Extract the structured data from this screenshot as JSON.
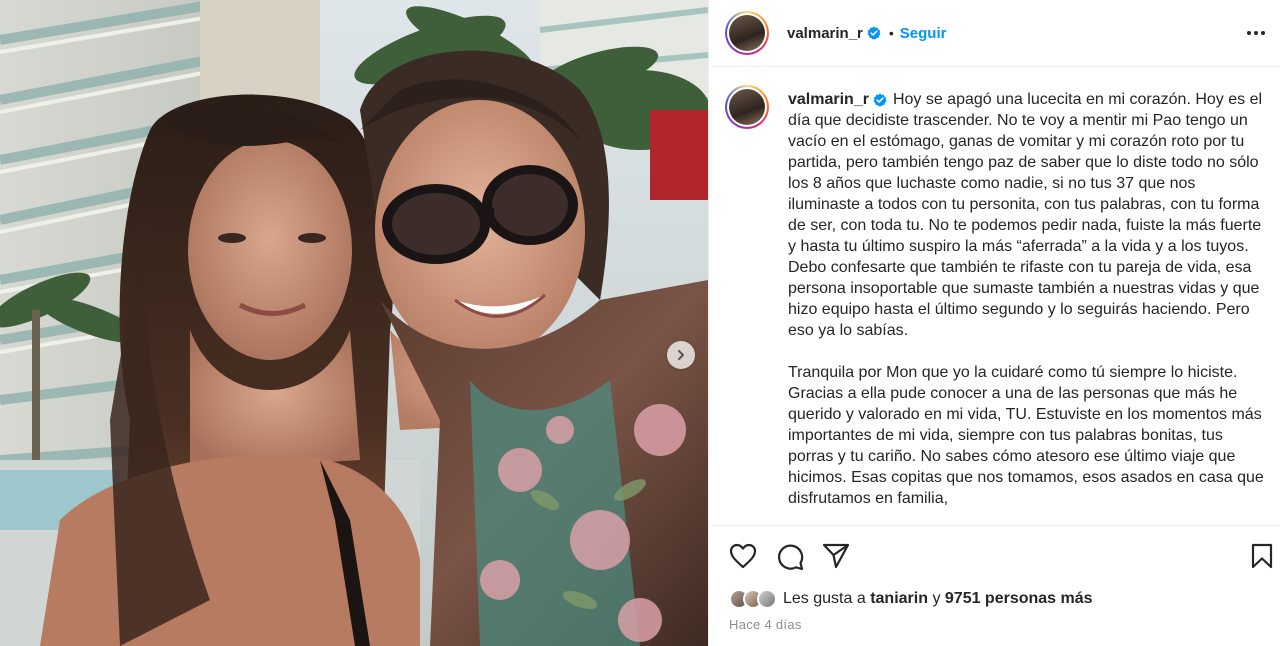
{
  "post": {
    "username": "valmarin_r",
    "follow_label": "Seguir",
    "dot": "•",
    "caption_username": "valmarin_r",
    "caption_paragraphs": [
      "Hoy se apagó una lucecita en mi corazón. Hoy es el día que decidiste trascender. No te voy a mentir mi Pao tengo un vacío en el estómago, ganas de vomitar y mi corazón roto por tu partida, pero también tengo paz de saber que lo diste todo no sólo los 8 años que luchaste como nadie, si no tus 37 que nos iluminaste a todos con tu personita, con tus palabras, con tu forma de ser, con toda tu. No te podemos pedir nada, fuiste la más fuerte y hasta tu último suspiro la más “aferrada” a la vida y a los tuyos.",
      "Debo confesarte que también te rifaste con tu pareja de vida, esa persona insoportable que sumaste también a nuestras vidas y que hizo equipo hasta el último segundo y lo seguirás haciendo. Pero eso ya lo sabías.",
      "Tranquila por Mon que yo la cuidaré como tú siempre lo hiciste. Gracias a ella pude conocer a una de las personas que más he querido y valorado en mi vida, TU. Estuviste en los momentos más importantes de mi vida, siempre con tus palabras bonitas, tus porras y tu cariño. No sabes cómo atesoro ese último viaje que hicimos. Esas copitas que nos tomamos, esos asados en casa que disfrutamos en familia,"
    ],
    "likes_prefix": "Les gusta a",
    "likes_user": "taniarin",
    "likes_connector": "y",
    "likes_count": "9751 personas más",
    "time_ago": "Hace 4 días"
  },
  "icons": {
    "verified": "verified-badge-icon",
    "more": "more-options-icon",
    "like": "heart-icon",
    "comment": "comment-icon",
    "share": "share-icon",
    "save": "bookmark-icon",
    "next": "chevron-right-icon"
  },
  "colors": {
    "accent": "#0095f6",
    "text": "#262626",
    "muted": "#8e8e8e",
    "border": "#efefef"
  }
}
